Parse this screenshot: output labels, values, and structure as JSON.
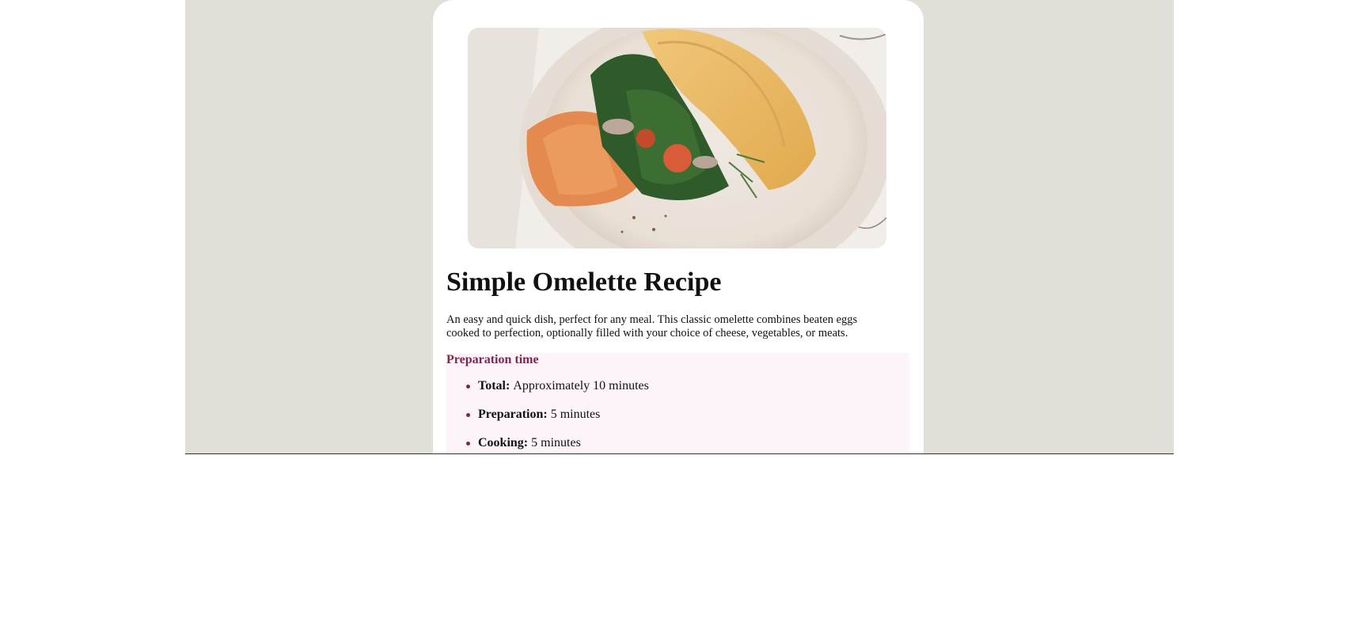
{
  "recipe": {
    "title": "Simple Omelette Recipe",
    "description": "An easy and quick dish, perfect for any meal. This classic omelette combines beaten eggs cooked to perfection, optionally filled with your choice of cheese, vegetables, or meats.",
    "image_icon": "omelette-photo",
    "preparation": {
      "heading": "Preparation time",
      "items": [
        {
          "label": "Total:",
          "value": "Approximately 10 minutes"
        },
        {
          "label": "Preparation:",
          "value": "5 minutes"
        },
        {
          "label": "Cooking:",
          "value": "5 minutes"
        }
      ]
    }
  },
  "colors": {
    "background": "#e2ded8",
    "card": "#ffffff",
    "accent": "#7a284e",
    "prep_background": "#fdf4fa"
  }
}
